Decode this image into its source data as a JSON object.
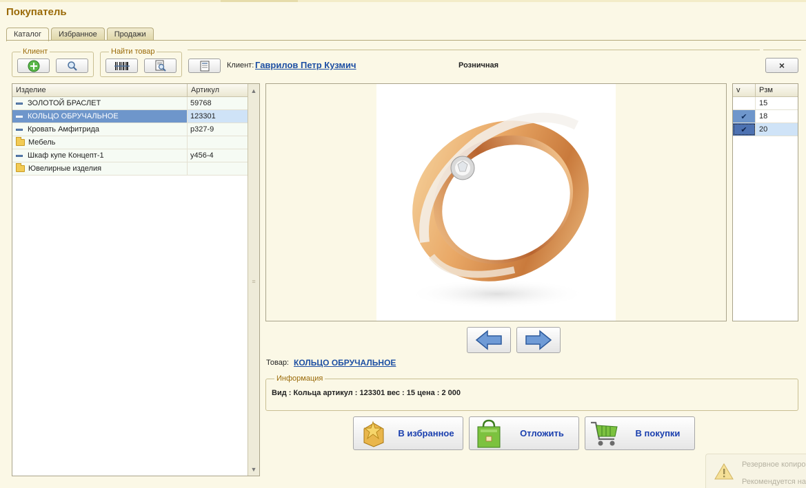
{
  "window": {
    "title": "Покупатель"
  },
  "tabs": [
    {
      "label": "Каталог",
      "active": true
    },
    {
      "label": "Избранное",
      "active": false
    },
    {
      "label": "Продажи",
      "active": false
    }
  ],
  "toolbar": {
    "client_group_title": "Клиент",
    "find_group_title": "Найти товар",
    "client_add_icon": "add-circle-icon",
    "client_search_icon": "magnifier-icon",
    "find_barcode_icon": "barcode-icon",
    "find_search_icon": "find-document-icon",
    "extra_icon": "list-icon"
  },
  "client": {
    "label": "Клиент:",
    "name": "Гаврилов Петр Кузмич",
    "price_type": "Розничная"
  },
  "close_button_label": "×",
  "catalog": {
    "columns": [
      "Изделие",
      "Артикул"
    ],
    "rows": [
      {
        "name": "ЗОЛОТОЙ БРАСЛЕТ",
        "article": "59768",
        "kind": "item",
        "selected": false
      },
      {
        "name": "КОЛЬЦО ОБРУЧАЛЬНОЕ",
        "article": "123301",
        "kind": "item",
        "selected": true
      },
      {
        "name": "Кровать Амфитрида",
        "article": "р327-9",
        "kind": "item",
        "selected": false
      },
      {
        "name": "Мебель",
        "article": "",
        "kind": "folder",
        "selected": false
      },
      {
        "name": "Шкаф купе Концепт-1",
        "article": "у456-4",
        "kind": "item",
        "selected": false
      },
      {
        "name": "Ювелирные изделия",
        "article": "",
        "kind": "folder",
        "selected": false
      }
    ]
  },
  "sizes": {
    "columns": [
      "v",
      "Рзм"
    ],
    "rows": [
      {
        "checked": false,
        "value": "15",
        "current": false
      },
      {
        "checked": true,
        "value": "18",
        "current": false
      },
      {
        "checked": true,
        "value": "20",
        "current": true
      }
    ],
    "check_glyph": "✔"
  },
  "product": {
    "label": "Товар:",
    "name": "КОЛЬЦО ОБРУЧАЛЬНОЕ ",
    "image_subject": "wedding-ring-with-diamond"
  },
  "info": {
    "title": "Информация",
    "text": "Вид : Кольца артикул : 123301 вес : 15 цена : 2 000"
  },
  "actions": {
    "favorite": "В избранное",
    "postpone": "Отложить",
    "buy": "В покупки"
  },
  "notification": {
    "line1": "Резервное копиро",
    "line2": "Рекомендуется на"
  },
  "colors": {
    "title": "#9a6a08",
    "link": "#1d4fa3",
    "selection": "#6e96cb",
    "action_text": "#1a3fae",
    "background": "#fbf8e6"
  }
}
